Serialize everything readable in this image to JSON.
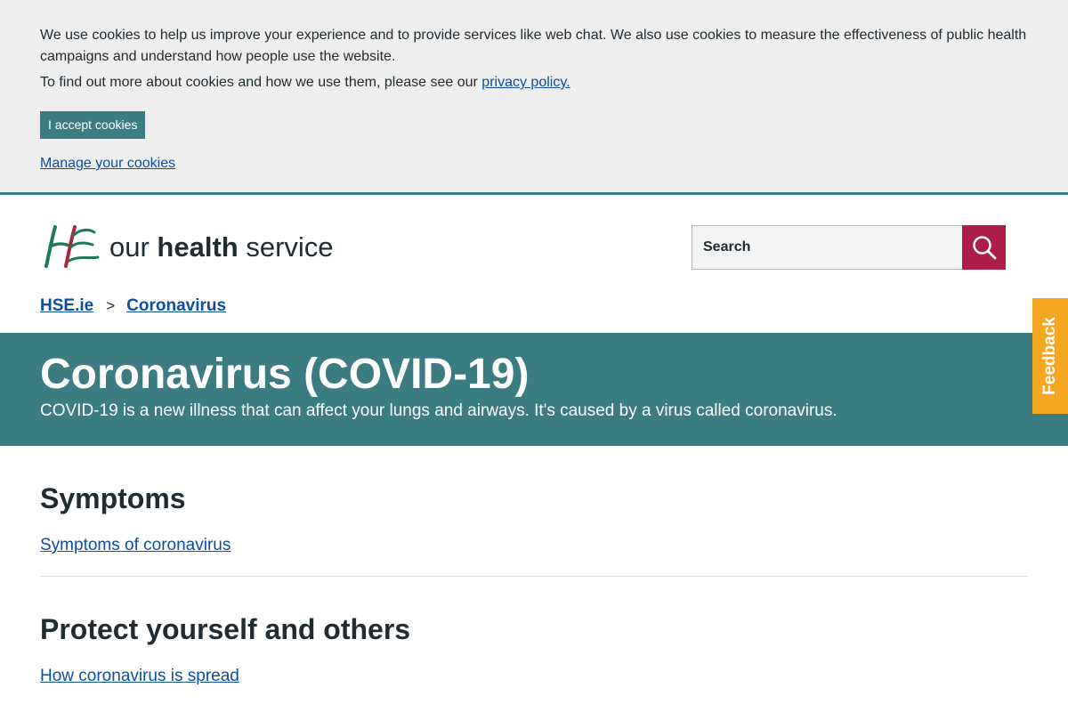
{
  "cookie_banner": {
    "text_line1": "We use cookies to help us improve your experience and to provide services like web chat. We also use cookies to measure the effectiveness of public health campaigns and understand how people use the website.",
    "text_line2_prefix": "To find out more about cookies and how we use them, please see our ",
    "privacy_link": "privacy policy.",
    "accept_label": "I accept cookies",
    "manage_label": "Manage your cookies"
  },
  "header": {
    "logo_letters": "HSE",
    "tagline_pre": "our ",
    "tagline_bold": "health",
    "tagline_post": " service",
    "search_placeholder": "Search",
    "search_icon": "search-icon"
  },
  "breadcrumb": {
    "items": [
      "HSE.ie",
      "Coronavirus"
    ],
    "separator": ">"
  },
  "hero": {
    "title": "Coronavirus (COVID-19)",
    "subtitle": "COVID-19 is a new illness that can affect your lungs and airways. It's caused by a virus called coronavirus."
  },
  "feedback_label": "Feedback",
  "sections": [
    {
      "heading": "Symptoms",
      "link": "Symptoms of coronavirus"
    },
    {
      "heading": "Protect yourself and others",
      "link": "How coronavirus is spread"
    }
  ],
  "colors": {
    "teal": "#3b7c83",
    "link": "#0b4ea2",
    "search_button": "#ad1d49",
    "feedback": "#f5a623"
  }
}
